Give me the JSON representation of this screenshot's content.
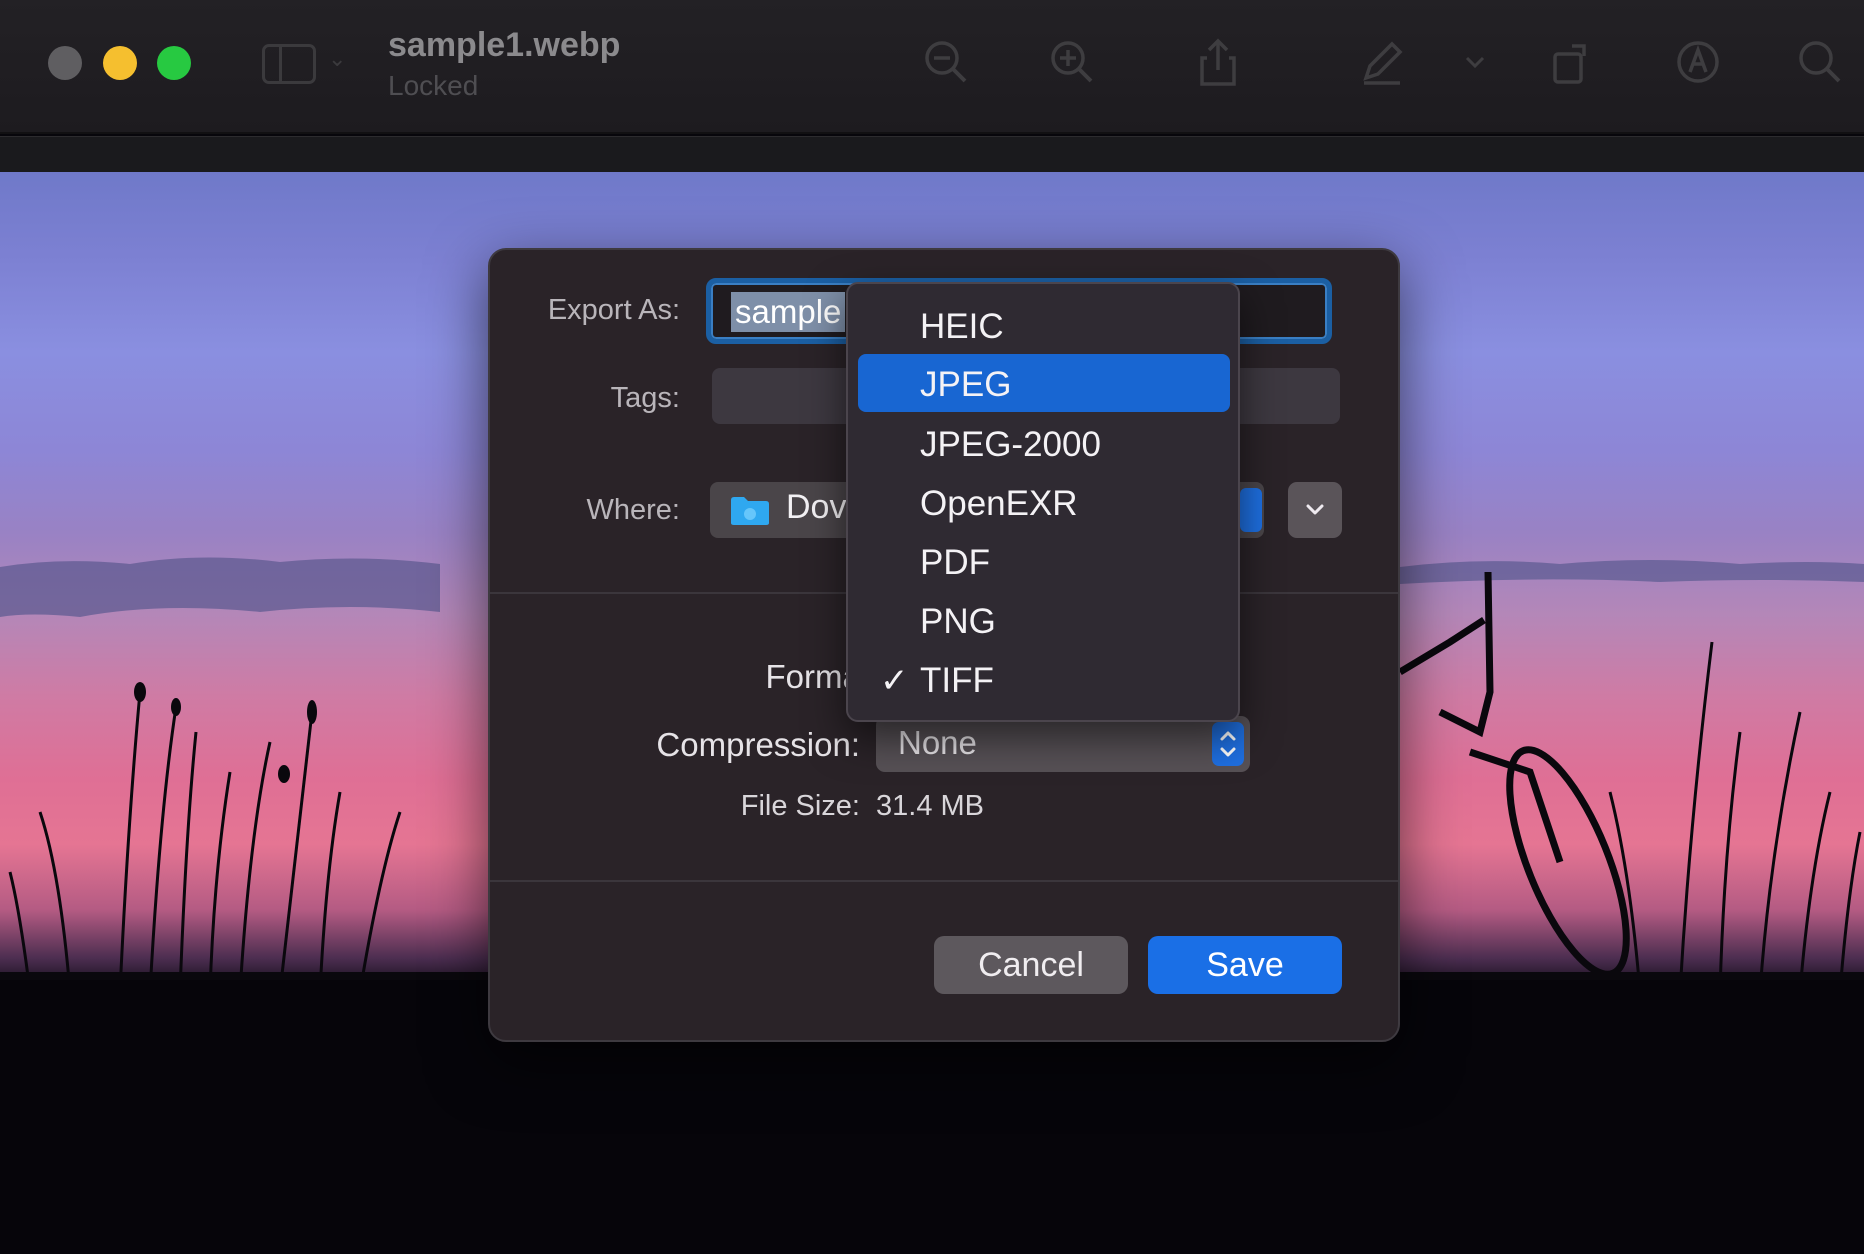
{
  "window": {
    "title": "sample1.webp",
    "subtitle": "Locked",
    "toolbar_icons": [
      "sidebar-icon",
      "zoom-out-icon",
      "zoom-in-icon",
      "share-icon",
      "markup-icon",
      "rotate-icon",
      "annotate-icon",
      "search-icon"
    ]
  },
  "dialog": {
    "export_as_label": "Export As:",
    "export_as_value": "sample",
    "tags_label": "Tags:",
    "where_label": "Where:",
    "where_value": "Dov",
    "format_label": "Format",
    "compression_label": "Compression:",
    "compression_value": "None",
    "file_size_label": "File Size:",
    "file_size_value": "31.4 MB",
    "cancel_label": "Cancel",
    "save_label": "Save"
  },
  "format_menu": {
    "items": [
      {
        "label": "HEIC",
        "checked": false,
        "highlighted": false
      },
      {
        "label": "JPEG",
        "checked": false,
        "highlighted": true
      },
      {
        "label": "JPEG-2000",
        "checked": false,
        "highlighted": false
      },
      {
        "label": "OpenEXR",
        "checked": false,
        "highlighted": false
      },
      {
        "label": "PDF",
        "checked": false,
        "highlighted": false
      },
      {
        "label": "PNG",
        "checked": false,
        "highlighted": false
      },
      {
        "label": "TIFF",
        "checked": true,
        "highlighted": false
      }
    ],
    "check_glyph": "✓"
  },
  "colors": {
    "accent": "#1a6fe6",
    "traffic_close": "#5f5e61",
    "traffic_minimize": "#f5bf2f",
    "traffic_maximize": "#27c941"
  }
}
